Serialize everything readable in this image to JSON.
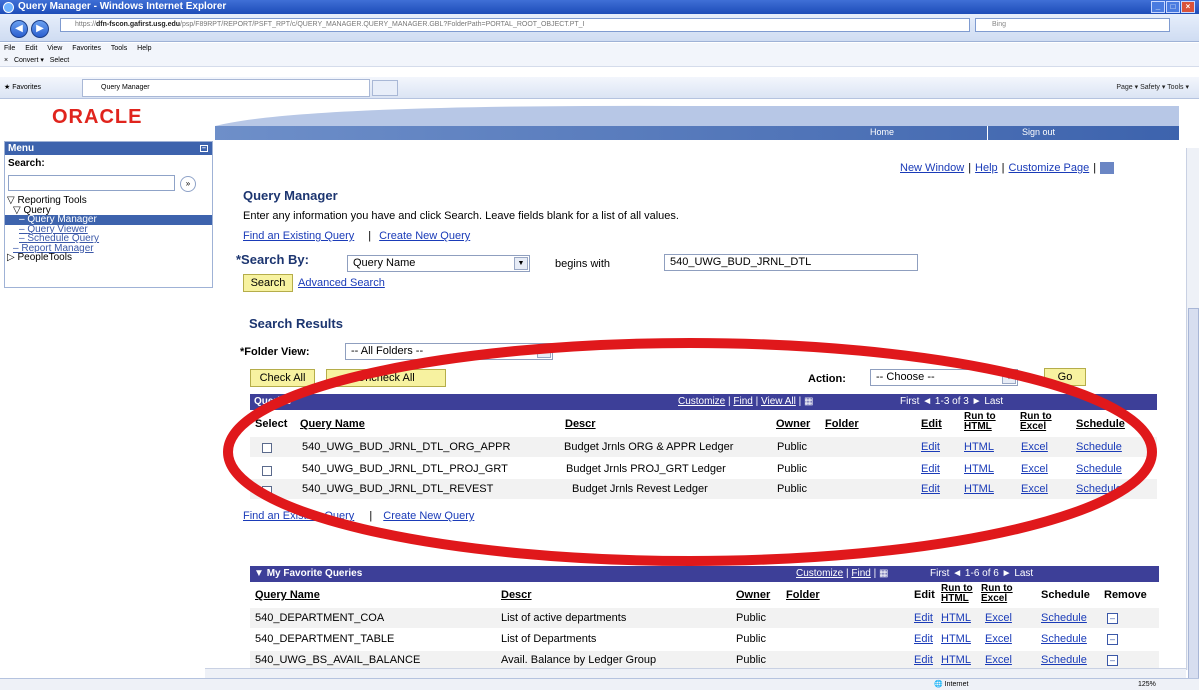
{
  "browser": {
    "title": "Query Manager - Windows Internet Explorer",
    "url_prefix": "https://",
    "url_host": "dfn-fscon.gafirst.usg.edu",
    "url_path": "/psp/F89RPT/REPORT/PSFT_RPT/c/QUERY_MANAGER.QUERY_MANAGER.GBL?FolderPath=PORTAL_ROOT_OBJECT.PT_I",
    "search_engine": "Bing",
    "menu": [
      "File",
      "Edit",
      "View",
      "Favorites",
      "Tools",
      "Help"
    ],
    "cmd": [
      "Convert",
      "Select"
    ],
    "favorites_label": "Favorites",
    "tab_label": "Query Manager",
    "toolbar_right": "Page ▾   Safety ▾   Tools ▾",
    "status_zone": "Internet",
    "zoom": "125%"
  },
  "header": {
    "logo": "ORACLE",
    "home": "Home",
    "signout": "Sign out"
  },
  "menu": {
    "title": "Menu",
    "search_label": "Search:",
    "items": [
      {
        "label": "Reporting Tools",
        "level": 0,
        "expanded": true
      },
      {
        "label": "Query",
        "level": 1,
        "expanded": true
      },
      {
        "label": "Query Manager",
        "level": 2,
        "selected": true
      },
      {
        "label": "Query Viewer",
        "level": 2
      },
      {
        "label": "Schedule Query",
        "level": 2
      },
      {
        "label": "Report Manager",
        "level": 1
      },
      {
        "label": "PeopleTools",
        "level": 0
      }
    ]
  },
  "toplinks": {
    "new_window": "New Window",
    "help": "Help",
    "customize": "Customize Page"
  },
  "page": {
    "title": "Query Manager",
    "instructions": "Enter any information you have and click Search. Leave fields blank for a list of all values.",
    "find_existing": "Find an Existing Query",
    "create_new": "Create New Query",
    "search_by_label": "*Search By:",
    "search_by_value": "Query Name",
    "begins_with": "begins with",
    "query_value": "540_UWG_BUD_JRNL_DTL",
    "search_btn": "Search",
    "advanced_search": "Advanced Search",
    "results_title": "Search Results",
    "folder_view_label": "*Folder View:",
    "folder_view_value": "-- All Folders --",
    "check_all": "Check All",
    "uncheck_all": "Uncheck All",
    "action_label": "Action:",
    "action_value": "-- Choose --",
    "go_btn": "Go"
  },
  "results_grid": {
    "title": "Queries",
    "customize": "Customize",
    "find": "Find",
    "view_all": "View All",
    "first": "First",
    "range": "1-3 of 3",
    "last": "Last",
    "headers": {
      "select": "Select",
      "name": "Query Name",
      "descr": "Descr",
      "owner": "Owner",
      "folder": "Folder",
      "edit": "Edit",
      "run_html": "Run to HTML",
      "run_excel": "Run to Excel",
      "schedule": "Schedule"
    },
    "rows": [
      {
        "name": "540_UWG_BUD_JRNL_DTL_ORG_APPR",
        "descr": "Budget Jrnls ORG & APPR Ledger",
        "owner": "Public",
        "edit": "Edit",
        "html": "HTML",
        "excel": "Excel",
        "schedule": "Schedule"
      },
      {
        "name": "540_UWG_BUD_JRNL_DTL_PROJ_GRT",
        "descr": "Budget Jrnls PROJ_GRT Ledger",
        "owner": "Public",
        "edit": "Edit",
        "html": "HTML",
        "excel": "Excel",
        "schedule": "Schedule"
      },
      {
        "name": "540_UWG_BUD_JRNL_DTL_REVEST",
        "descr": "Budget Jrnls Revest Ledger",
        "owner": "Public",
        "edit": "Edit",
        "html": "HTML",
        "excel": "Excel",
        "schedule": "Schedule"
      }
    ],
    "find_existing": "Find an Existing Query",
    "create_new": "Create New Query"
  },
  "favorites_grid": {
    "title": "My Favorite Queries",
    "customize": "Customize",
    "find": "Find",
    "first": "First",
    "range": "1-6 of 6",
    "last": "Last",
    "headers": {
      "name": "Query Name",
      "descr": "Descr",
      "owner": "Owner",
      "folder": "Folder",
      "edit": "Edit",
      "run_html": "Run to HTML",
      "run_excel": "Run to Excel",
      "schedule": "Schedule",
      "remove": "Remove"
    },
    "rows": [
      {
        "name": "540_DEPARTMENT_COA",
        "descr": "List of active departments",
        "owner": "Public",
        "edit": "Edit",
        "html": "HTML",
        "excel": "Excel",
        "schedule": "Schedule"
      },
      {
        "name": "540_DEPARTMENT_TABLE",
        "descr": "List of Departments",
        "owner": "Public",
        "edit": "Edit",
        "html": "HTML",
        "excel": "Excel",
        "schedule": "Schedule"
      },
      {
        "name": "540_UWG_BS_AVAIL_BALANCE",
        "descr": "Avail. Balance by Ledger Group",
        "owner": "Public",
        "edit": "Edit",
        "html": "HTML",
        "excel": "Excel",
        "schedule": "Schedule"
      }
    ]
  },
  "colors": {
    "grid_header": "#3d3f98",
    "oval": "#e0181b",
    "oracle_red": "#e0241d",
    "menu_blue": "#3d63ad"
  }
}
